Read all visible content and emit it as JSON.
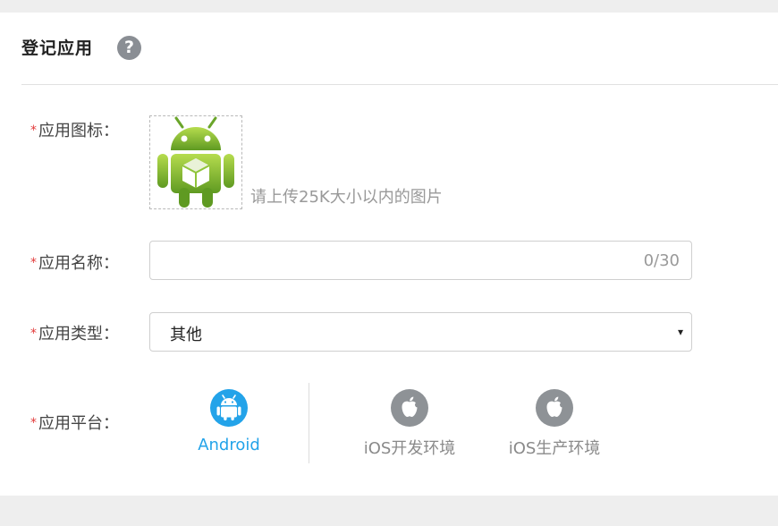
{
  "header": {
    "title": "登记应用",
    "help_icon": "?"
  },
  "form": {
    "required_mark": "*",
    "icon": {
      "label": "应用图标：",
      "hint": "请上传25K大小以内的图片",
      "preview": "android-robot-icon"
    },
    "name": {
      "label": "应用名称：",
      "value": "",
      "counter": "0/30"
    },
    "type": {
      "label": "应用类型：",
      "selected": "其他",
      "arrow": "▾"
    },
    "platform": {
      "label": "应用平台：",
      "options": [
        {
          "label": "Android",
          "icon": "android-icon",
          "selected": true
        },
        {
          "label": "iOS开发环境",
          "icon": "apple-icon",
          "selected": false
        },
        {
          "label": "iOS生产环境",
          "icon": "apple-icon",
          "selected": false
        }
      ]
    }
  },
  "colors": {
    "accent": "#23a3e9",
    "inactive_icon": "#8e9296",
    "required": "#e23a3a",
    "android_green": "#8fc43a"
  }
}
